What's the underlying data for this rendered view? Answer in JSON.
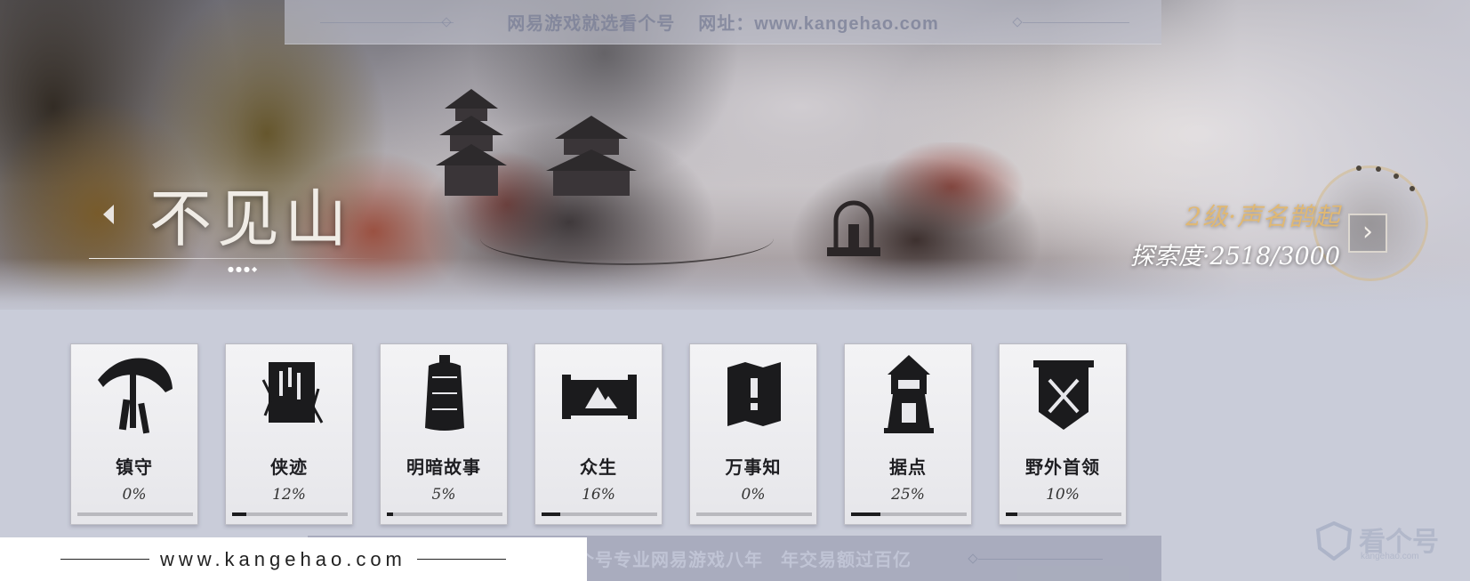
{
  "watermarks": {
    "top_left": "网易游戏就选看个号",
    "top_right": "网址：www.kangehao.com",
    "bottom_left": "看个号专业网易游戏八年",
    "bottom_right": "年交易额过百亿",
    "site": "www.kangehao.com",
    "logo_text": "看个号",
    "logo_sub": "kangehao.com"
  },
  "region": {
    "title": "不见山",
    "level": "2级·声名鹊起",
    "exploration": "探索度·2518/3000",
    "back_icon": "left-triangle-icon",
    "next_icon": "chevron-right-icon",
    "next_glyph": "›"
  },
  "colors": {
    "accent_gold": "#e0b873",
    "card_bg": "#f0f0f3",
    "progress_fill": "#1c1c1e"
  },
  "cards": [
    {
      "label": "镇守",
      "percent": "0%",
      "progress": 0.0,
      "icon": "umbrella-hat-icon"
    },
    {
      "label": "侠迹",
      "percent": "12%",
      "progress": 0.12,
      "icon": "scroll-book-icon"
    },
    {
      "label": "明暗故事",
      "percent": "5%",
      "progress": 0.05,
      "icon": "bell-icon"
    },
    {
      "label": "众生",
      "percent": "16%",
      "progress": 0.16,
      "icon": "painting-scroll-icon"
    },
    {
      "label": "万事知",
      "percent": "0%",
      "progress": 0.0,
      "icon": "folded-map-icon"
    },
    {
      "label": "据点",
      "percent": "25%",
      "progress": 0.25,
      "icon": "watchtower-icon"
    },
    {
      "label": "野外首领",
      "percent": "10%",
      "progress": 0.1,
      "icon": "crossed-swords-banner-icon"
    }
  ]
}
